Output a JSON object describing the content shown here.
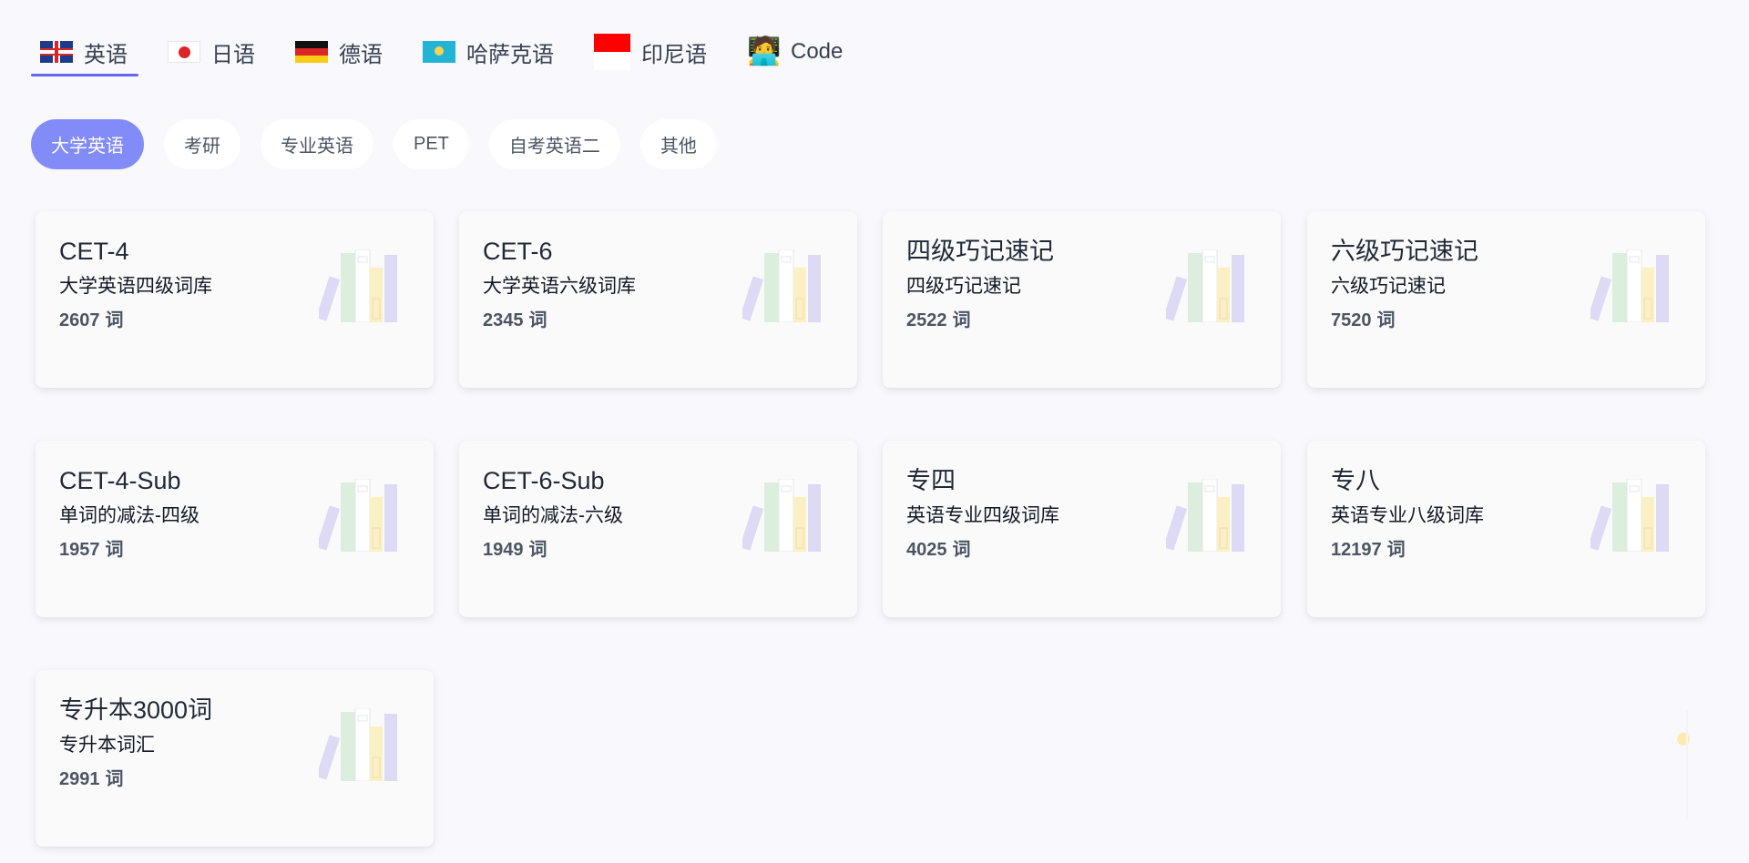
{
  "languages": [
    {
      "label": "英语",
      "flag": "gb",
      "active": true
    },
    {
      "label": "日语",
      "flag": "jp",
      "active": false
    },
    {
      "label": "德语",
      "flag": "de",
      "active": false
    },
    {
      "label": "哈萨克语",
      "flag": "kz",
      "active": false
    },
    {
      "label": "印尼语",
      "flag": "id",
      "active": false
    },
    {
      "label": "Code",
      "flag": "code",
      "icon": "🧑‍💻",
      "active": false
    }
  ],
  "categories": [
    {
      "label": "大学英语",
      "active": true
    },
    {
      "label": "考研",
      "active": false
    },
    {
      "label": "专业英语",
      "active": false
    },
    {
      "label": "PET",
      "active": false
    },
    {
      "label": "自考英语二",
      "active": false
    },
    {
      "label": "其他",
      "active": false
    }
  ],
  "unit": "词",
  "cards": [
    {
      "title": "CET-4",
      "desc": "大学英语四级词库",
      "count": "2607"
    },
    {
      "title": "CET-6",
      "desc": "大学英语六级词库",
      "count": "2345"
    },
    {
      "title": "四级巧记速记",
      "desc": "四级巧记速记",
      "count": "2522"
    },
    {
      "title": "六级巧记速记",
      "desc": "六级巧记速记",
      "count": "7520"
    },
    {
      "title": "CET-4-Sub",
      "desc": "单词的减法-四级",
      "count": "1957"
    },
    {
      "title": "CET-6-Sub",
      "desc": "单词的减法-六级",
      "count": "1949"
    },
    {
      "title": "专四",
      "desc": "英语专业四级词库",
      "count": "4025"
    },
    {
      "title": "专八",
      "desc": "英语专业八级词库",
      "count": "12197"
    },
    {
      "title": "专升本3000词",
      "desc": "专升本词汇",
      "count": "2991"
    }
  ],
  "colors": {
    "accent": "#818cf8",
    "underline": "#6366f1",
    "book_purple": "#dcdaf4",
    "book_green": "#dceedd",
    "book_yellow": "#fbefc4"
  }
}
